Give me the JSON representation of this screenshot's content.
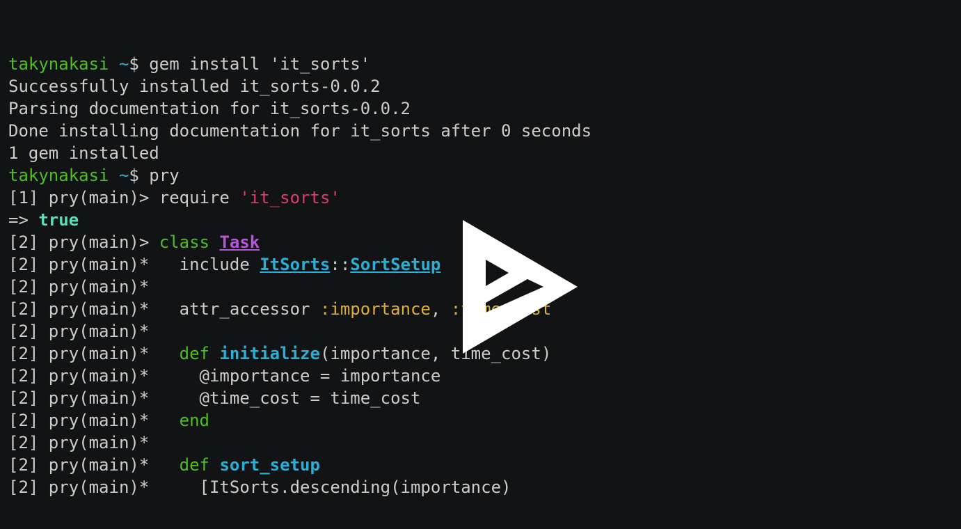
{
  "terminal": {
    "lines": [
      [
        {
          "t": "takynakasi ",
          "c": "green"
        },
        {
          "t": "~",
          "c": "cyan"
        },
        {
          "t": "$ gem install 'it_sorts'",
          "c": "default"
        }
      ],
      [
        {
          "t": "Successfully installed it_sorts-0.0.2",
          "c": "default"
        }
      ],
      [
        {
          "t": "Parsing documentation for it_sorts-0.0.2",
          "c": "default"
        }
      ],
      [
        {
          "t": "Done installing documentation for it_sorts after 0 seconds",
          "c": "default"
        }
      ],
      [
        {
          "t": "1 gem installed",
          "c": "default"
        }
      ],
      [
        {
          "t": "takynakasi ",
          "c": "green"
        },
        {
          "t": "~",
          "c": "cyan"
        },
        {
          "t": "$ pry",
          "c": "default"
        }
      ],
      [
        {
          "t": "[1] pry(main)> require ",
          "c": "default"
        },
        {
          "t": "'it_sorts'",
          "c": "red"
        }
      ],
      [
        {
          "t": "=> ",
          "c": "default"
        },
        {
          "t": "true",
          "c": "teal-bold"
        }
      ],
      [
        {
          "t": "[2] pry(main)> ",
          "c": "default"
        },
        {
          "t": "class ",
          "c": "green"
        },
        {
          "t": "Task",
          "c": "purple-bold-ul"
        }
      ],
      [
        {
          "t": "[2] pry(main)*   include ",
          "c": "default"
        },
        {
          "t": "ItSorts",
          "c": "cyan-bold-ul"
        },
        {
          "t": "::",
          "c": "default"
        },
        {
          "t": "SortSetup",
          "c": "cyan-bold-ul"
        }
      ],
      [
        {
          "t": "[2] pry(main)*",
          "c": "default"
        }
      ],
      [
        {
          "t": "[2] pry(main)*   attr_accessor ",
          "c": "default"
        },
        {
          "t": ":importance",
          "c": "yellow"
        },
        {
          "t": ", ",
          "c": "default"
        },
        {
          "t": ":time_cost",
          "c": "yellow"
        }
      ],
      [
        {
          "t": "[2] pry(main)*",
          "c": "default"
        }
      ],
      [
        {
          "t": "[2] pry(main)*   ",
          "c": "default"
        },
        {
          "t": "def ",
          "c": "green"
        },
        {
          "t": "initialize",
          "c": "cyan-bold"
        },
        {
          "t": "(importance, time_cost)",
          "c": "default"
        }
      ],
      [
        {
          "t": "[2] pry(main)*     @importance = importance",
          "c": "default"
        }
      ],
      [
        {
          "t": "[2] pry(main)*     @time_cost = time_cost",
          "c": "default"
        }
      ],
      [
        {
          "t": "[2] pry(main)*   ",
          "c": "default"
        },
        {
          "t": "end",
          "c": "green"
        }
      ],
      [
        {
          "t": "[2] pry(main)*",
          "c": "default"
        }
      ],
      [
        {
          "t": "[2] pry(main)*   ",
          "c": "default"
        },
        {
          "t": "def ",
          "c": "green"
        },
        {
          "t": "sort_setup",
          "c": "cyan-bold"
        }
      ],
      [
        {
          "t": "[2] pry(main)*     [ItSorts.descending(importance)",
          "c": "default"
        }
      ]
    ]
  },
  "overlay": {
    "icon": "play-icon"
  }
}
